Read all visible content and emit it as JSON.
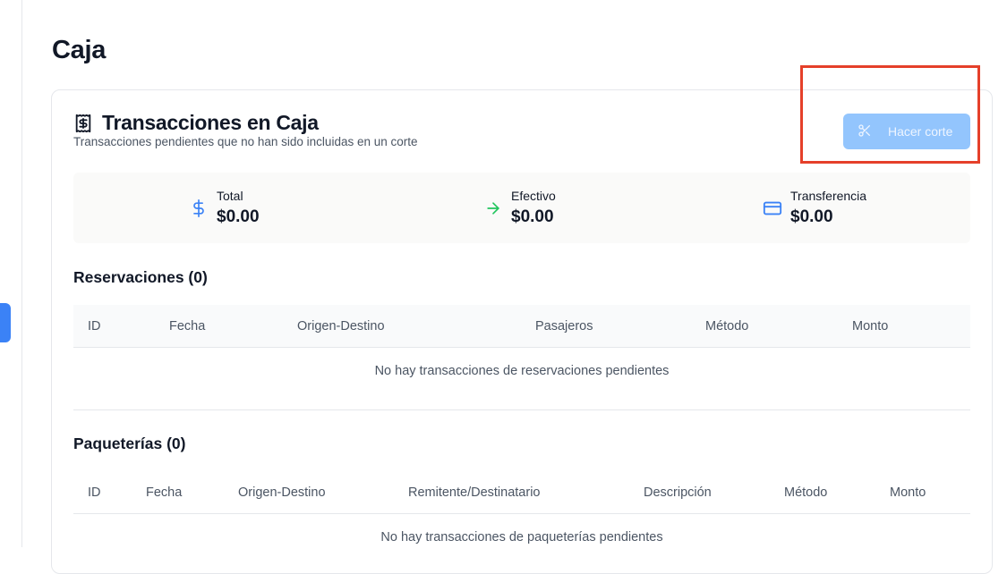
{
  "page": {
    "title": "Caja"
  },
  "card": {
    "title": "Transacciones en Caja",
    "subtitle": "Transacciones pendientes que no han sido incluidas en un corte",
    "title_icon": "receipt-dollar-icon",
    "cut_button": {
      "label": "Hacer corte",
      "icon": "scissors-icon",
      "disabled": true
    }
  },
  "summary": {
    "total": {
      "label": "Total",
      "value": "$0.00",
      "icon": "dollar-sign-icon",
      "color": "#3b82f6"
    },
    "cash": {
      "label": "Efectivo",
      "value": "$0.00",
      "icon": "arrow-right-icon",
      "color": "#22c55e"
    },
    "transfer": {
      "label": "Transferencia",
      "value": "$0.00",
      "icon": "credit-card-icon",
      "color": "#3b82f6"
    }
  },
  "reservations": {
    "title": "Reservaciones (0)",
    "columns": [
      "ID",
      "Fecha",
      "Origen-Destino",
      "Pasajeros",
      "Método",
      "Monto"
    ],
    "empty_message": "No hay transacciones de reservaciones pendientes"
  },
  "packages": {
    "title": "Paqueterías (0)",
    "columns": [
      "ID",
      "Fecha",
      "Origen-Destino",
      "Remitente/Destinatario",
      "Descripción",
      "Método",
      "Monto"
    ],
    "empty_message": "No hay transacciones de paqueterías pendientes"
  },
  "colors": {
    "accent": "#3b82f6",
    "button_disabled": "#93c5fd",
    "highlight": "#e5402a"
  }
}
